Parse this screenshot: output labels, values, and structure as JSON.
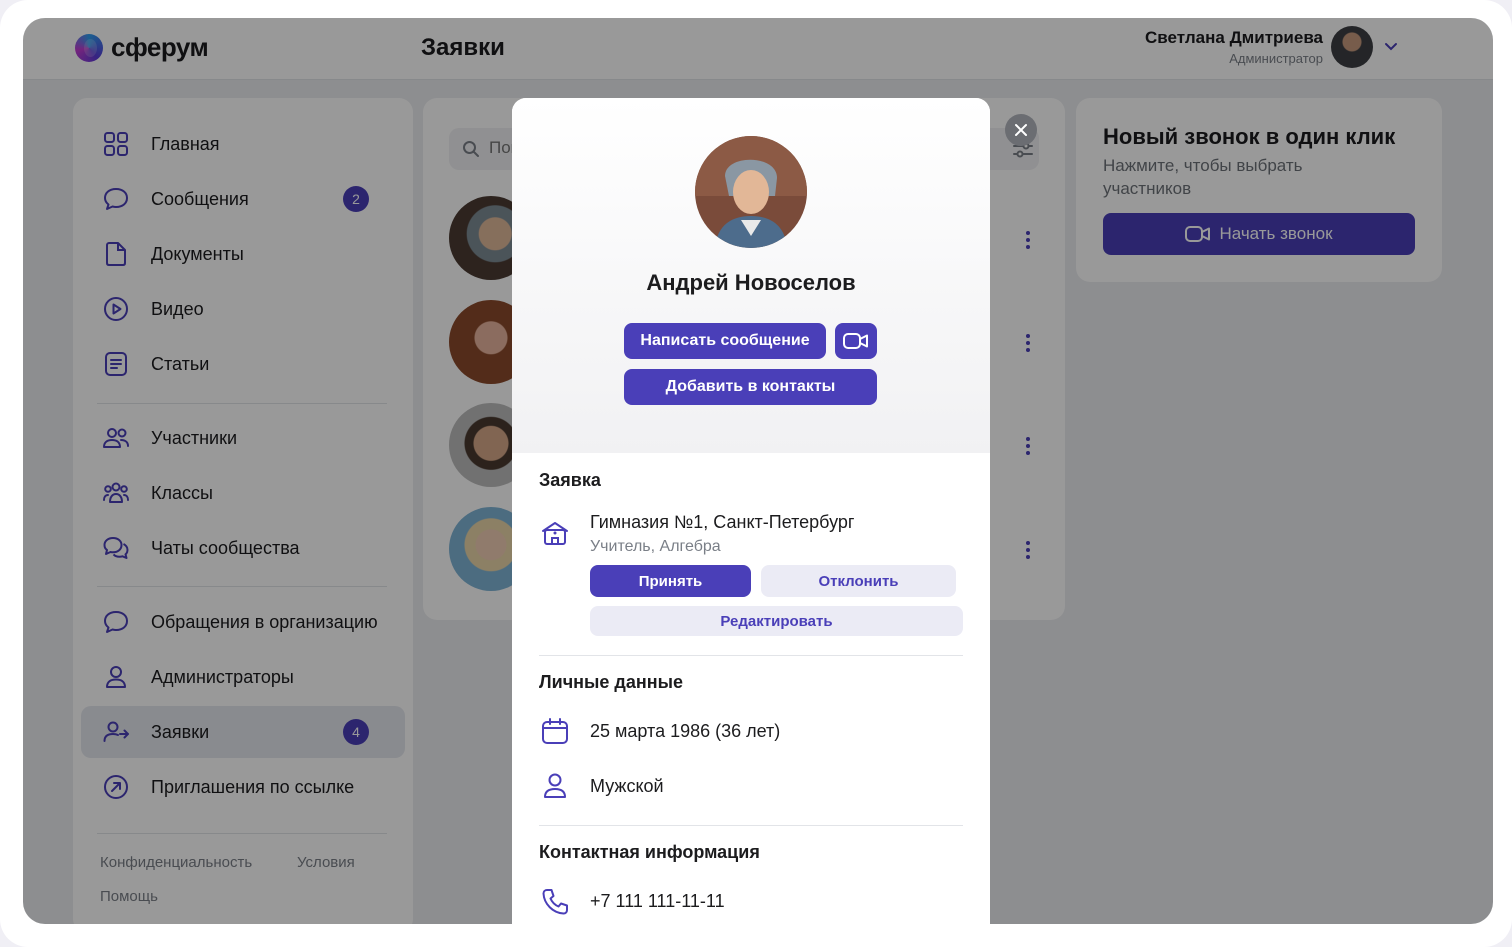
{
  "app": {
    "logo_text": "сферум",
    "page_title": "Заявки"
  },
  "user": {
    "name": "Светлана Дмитриева",
    "role": "Администратор"
  },
  "sidebar": {
    "items": [
      {
        "label": "Главная",
        "icon": "home-grid-icon"
      },
      {
        "label": "Сообщения",
        "icon": "message-icon",
        "badge": "2"
      },
      {
        "label": "Документы",
        "icon": "document-icon"
      },
      {
        "label": "Видео",
        "icon": "video-play-icon"
      },
      {
        "label": "Статьи",
        "icon": "article-icon"
      },
      {
        "label": "Участники",
        "icon": "members-icon"
      },
      {
        "label": "Классы",
        "icon": "classes-icon"
      },
      {
        "label": "Чаты сообщества",
        "icon": "community-chats-icon"
      },
      {
        "label": "Обращения в организацию",
        "icon": "org-message-icon"
      },
      {
        "label": "Администраторы",
        "icon": "admin-user-icon"
      },
      {
        "label": "Заявки",
        "icon": "requests-icon",
        "badge": "4",
        "active": true
      },
      {
        "label": "Приглашения по ссылке",
        "icon": "invite-link-icon"
      }
    ],
    "footer": {
      "privacy": "Конфиденциальность",
      "terms": "Условия",
      "help": "Помощь"
    }
  },
  "list": {
    "search_placeholder": "Поиск"
  },
  "promo": {
    "title": "Новый звонок в один клик",
    "subtitle": "Нажмите, чтобы выбрать участников",
    "button_label": "Начать звонок"
  },
  "modal": {
    "name": "Андрей Новоселов",
    "write_message_label": "Написать сообщение",
    "add_contact_label": "Добавить в контакты",
    "request": {
      "section_title": "Заявка",
      "school": "Гимназия №1, Санкт-Петербург",
      "role": "Учитель, Алгебра",
      "accept_label": "Принять",
      "decline_label": "Отклонить",
      "edit_label": "Редактировать"
    },
    "personal": {
      "section_title": "Личные данные",
      "birthdate": "25 марта 1986 (36 лет)",
      "gender": "Мужской"
    },
    "contact": {
      "section_title": "Контактная информация",
      "phone": "+7 111 111-11-11"
    }
  },
  "colors": {
    "accent": "#4a3fb8",
    "badge": "#4a3fb8",
    "secondary_button_bg": "#ebebf5",
    "overlay": "rgba(0,0,0,0.40)"
  }
}
